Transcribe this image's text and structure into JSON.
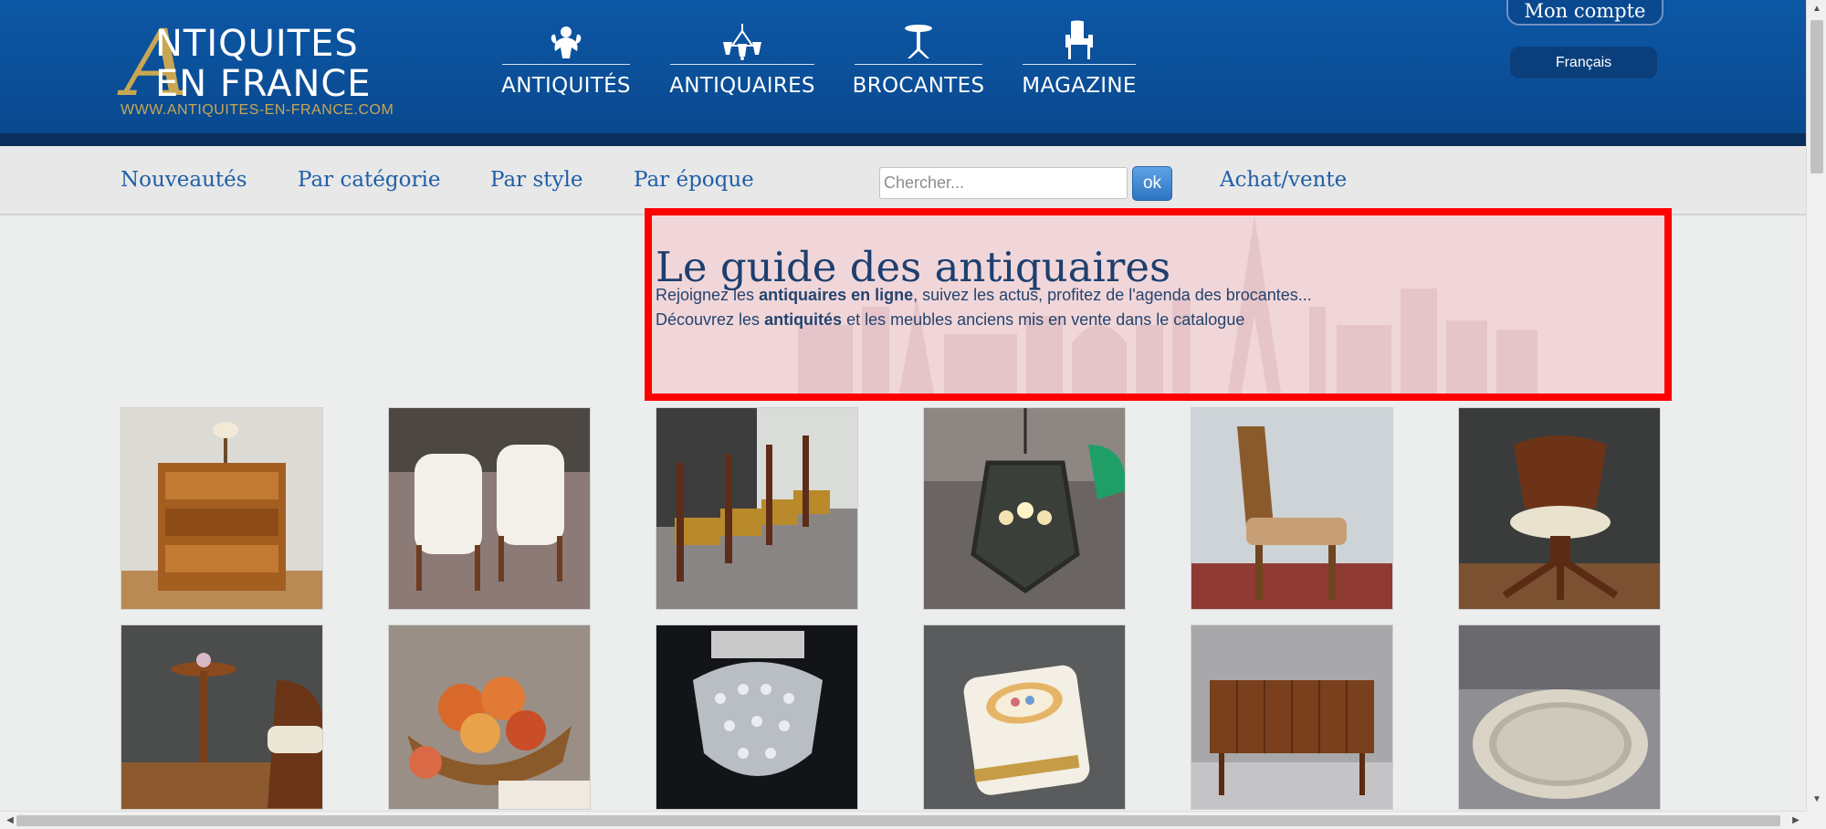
{
  "header": {
    "logo": {
      "letter": "A",
      "line1": "NTIQUITES",
      "line2": "EN FRANCE",
      "url": "WWW.ANTIQUITES-EN-FRANCE.COM"
    },
    "nav": [
      {
        "label": "ANTIQUITÉS",
        "icon": "cherub-icon"
      },
      {
        "label": "ANTIQUAIRES",
        "icon": "chandelier-icon"
      },
      {
        "label": "BROCANTES",
        "icon": "gueridon-table-icon"
      },
      {
        "label": "MAGAZINE",
        "icon": "armchair-icon"
      }
    ],
    "account_label": "Mon compte",
    "language_label": "Français"
  },
  "subnav": {
    "items": [
      "Nouveautés",
      "Par catégorie",
      "Par style",
      "Par époque"
    ],
    "search_placeholder": "Chercher...",
    "search_button": "ok",
    "trade_link": "Achat/vente"
  },
  "hero": {
    "title": "Le guide des antiquaires",
    "line1_pre": "Rejoignez les ",
    "line1_bold": "antiquaires en ligne",
    "line1_post": ", suivez les actus, profitez de l'agenda des brocantes...",
    "line2_pre": "Découvrez les ",
    "line2_bold": "antiquités",
    "line2_post": " et les meubles anciens mis en vente dans le catalogue"
  },
  "products": [
    {
      "subject": "revolving bookcase"
    },
    {
      "subject": "pair of white armchairs"
    },
    {
      "subject": "set of dining chairs"
    },
    {
      "subject": "lantern chandelier"
    },
    {
      "subject": "oak chair"
    },
    {
      "subject": "office armchair"
    },
    {
      "subject": "pedestal table"
    },
    {
      "subject": "still life painting with fruit"
    },
    {
      "subject": "crystal chandelier"
    },
    {
      "subject": "porcelain box"
    },
    {
      "subject": "sideboard"
    },
    {
      "subject": "silver tray"
    }
  ],
  "colors": {
    "header_blue": "#0b4f98",
    "gold": "#c9a752",
    "link_blue": "#1f5ea8",
    "highlight_red": "#ff0000"
  }
}
